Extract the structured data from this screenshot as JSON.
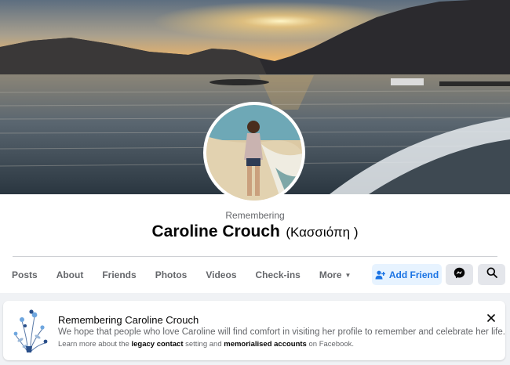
{
  "profile": {
    "remembering_label": "Remembering",
    "name": "Caroline Crouch",
    "alternate_name": "(Κασσιόπη )"
  },
  "tabs": [
    {
      "label": "Posts"
    },
    {
      "label": "About"
    },
    {
      "label": "Friends"
    },
    {
      "label": "Photos"
    },
    {
      "label": "Videos"
    },
    {
      "label": "Check-ins"
    },
    {
      "label": "More"
    }
  ],
  "actions": {
    "add_friend_label": "Add Friend",
    "message_icon": "messenger-icon",
    "search_icon": "search-icon"
  },
  "memorial_banner": {
    "title": "Remembering Caroline Crouch",
    "body": "We hope that people who love Caroline will find comfort in visiting her profile to remember and celebrate her life.",
    "learn_prefix": "Learn more about the ",
    "legacy_link": "legacy contact",
    "learn_middle": " setting and ",
    "memorial_link": "memorialised accounts",
    "learn_suffix": " on Facebook."
  },
  "colors": {
    "accent": "#1b74e4",
    "accent_bg": "#e7f3ff",
    "secondary_text": "#65676b",
    "page_bg": "#f0f2f5"
  }
}
